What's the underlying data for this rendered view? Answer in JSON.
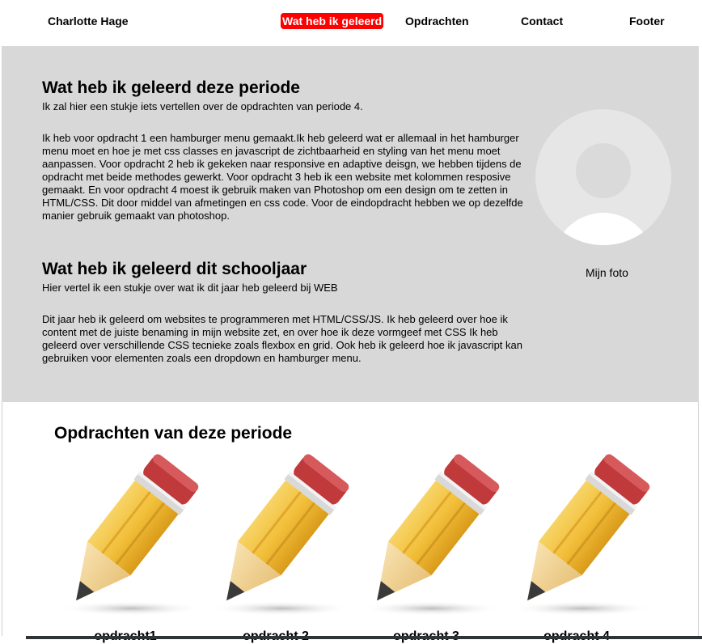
{
  "nav": {
    "brand": "Charlotte Hage",
    "items": [
      {
        "label": "Wat heb ik geleerd",
        "active": true
      },
      {
        "label": "Opdrachten",
        "active": false
      },
      {
        "label": "Contact",
        "active": false
      },
      {
        "label": "Footer",
        "active": false
      }
    ],
    "active_color": "#ff0000"
  },
  "about": {
    "background": "#d8d8d8",
    "period_title": "Wat heb ik geleerd deze periode",
    "period_subtitle": "Ik zal hier een stukje iets vertellen over de opdrachten van periode 4.",
    "period_text": "Ik heb voor opdracht 1 een hamburger menu gemaakt.Ik heb geleerd wat er allemaal in het hamburger menu moet en hoe je met css classes en javascript de zichtbaarheid en styling van het menu moet aanpassen. Voor opdracht 2 heb ik gekeken naar responsive en adaptive deisgn, we hebben tijdens de opdracht met beide methodes gewerkt. Voor opdracht 3 heb ik een website met kolommen resposive gemaakt. En voor opdracht 4 moest ik gebruik maken van Photoshop om een design om te zetten in HTML/CSS. Dit door middel van afmetingen en css code. Voor de eindopdracht hebben we op dezelfde manier gebruik gemaakt van photoshop.",
    "year_title": "Wat heb ik geleerd dit schooljaar",
    "year_subtitle": "Hier vertel ik een stukje over wat ik dit jaar heb geleerd bij WEB",
    "year_text": "Dit jaar heb ik geleerd om websites te programmeren met HTML/CSS/JS. Ik heb geleerd over hoe ik content met de juiste benaming in mijn website zet, en over hoe ik deze vormgeef met CSS Ik heb geleerd over verschillende CSS tecnieke zoals flexbox en grid. Ook heb ik geleerd hoe ik javascript kan gebruiken voor elementen zoals een dropdown en hamburger menu.",
    "photo_icon": "user-avatar-icon",
    "photo_caption": "Mijn foto"
  },
  "assignments": {
    "title": "Opdrachten van deze periode",
    "icon": "pencil-icon",
    "cards": [
      {
        "label": "opdracht1"
      },
      {
        "label": "opdracht 2"
      },
      {
        "label": "opdracht 3"
      },
      {
        "label": "opdracht 4"
      }
    ]
  }
}
